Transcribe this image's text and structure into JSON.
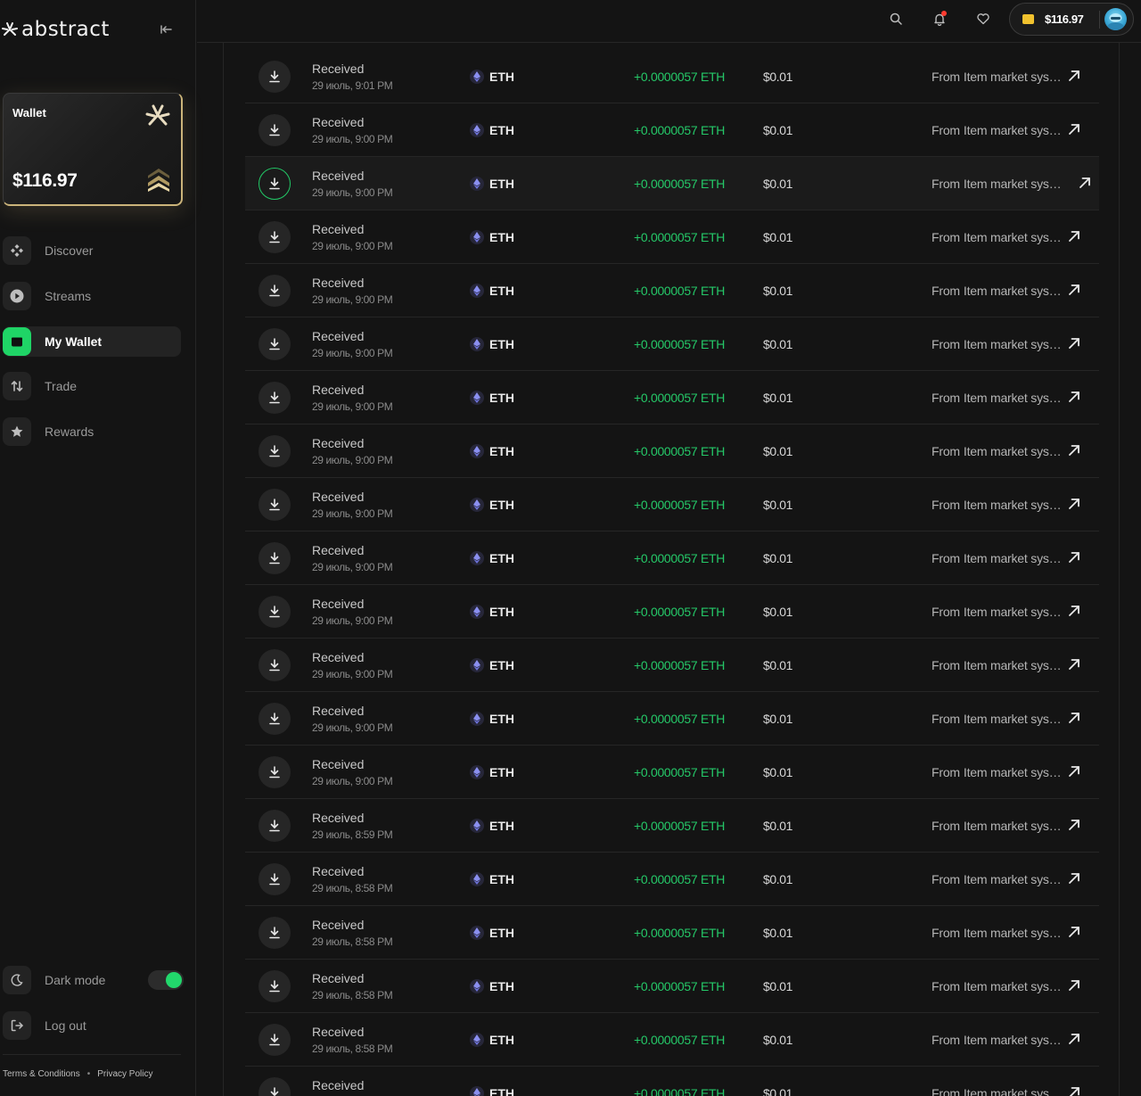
{
  "app": {
    "brand": "abstract"
  },
  "wallet_card": {
    "label": "Wallet",
    "balance": "$116.97",
    "accent_color": "#cbb47a"
  },
  "nav": {
    "items": [
      {
        "label": "Discover",
        "icon": "diamond-grid-icon",
        "active": false
      },
      {
        "label": "Streams",
        "icon": "play-icon",
        "active": false
      },
      {
        "label": "My Wallet",
        "icon": "wallet-icon",
        "active": true
      },
      {
        "label": "Trade",
        "icon": "swap-arrows-icon",
        "active": false
      },
      {
        "label": "Rewards",
        "icon": "star-icon",
        "active": false
      }
    ],
    "active_color": "#1fd466"
  },
  "bottom": {
    "dark_mode_label": "Dark mode",
    "dark_mode_on": true,
    "logout_label": "Log out"
  },
  "footer": {
    "terms": "Terms & Conditions",
    "separator": "•",
    "privacy": "Privacy Policy"
  },
  "header": {
    "balance": "$116.97",
    "has_notification": true
  },
  "transactions": [
    {
      "title": "Received",
      "date": "29 июль, 9:01 PM",
      "token": "ETH",
      "amount": "+0.0000057 ETH",
      "usd": "$0.01",
      "from_label": "From",
      "from": "Item market system"
    },
    {
      "title": "Received",
      "date": "29 июль, 9:00 PM",
      "token": "ETH",
      "amount": "+0.0000057 ETH",
      "usd": "$0.01",
      "from_label": "From",
      "from": "Item market system"
    },
    {
      "title": "Received",
      "date": "29 июль, 9:00 PM",
      "token": "ETH",
      "amount": "+0.0000057 ETH",
      "usd": "$0.01",
      "from_label": "From",
      "from": "Item market system"
    },
    {
      "title": "Received",
      "date": "29 июль, 9:00 PM",
      "token": "ETH",
      "amount": "+0.0000057 ETH",
      "usd": "$0.01",
      "from_label": "From",
      "from": "Item market system"
    },
    {
      "title": "Received",
      "date": "29 июль, 9:00 PM",
      "token": "ETH",
      "amount": "+0.0000057 ETH",
      "usd": "$0.01",
      "from_label": "From",
      "from": "Item market system"
    },
    {
      "title": "Received",
      "date": "29 июль, 9:00 PM",
      "token": "ETH",
      "amount": "+0.0000057 ETH",
      "usd": "$0.01",
      "from_label": "From",
      "from": "Item market system"
    },
    {
      "title": "Received",
      "date": "29 июль, 9:00 PM",
      "token": "ETH",
      "amount": "+0.0000057 ETH",
      "usd": "$0.01",
      "from_label": "From",
      "from": "Item market system"
    },
    {
      "title": "Received",
      "date": "29 июль, 9:00 PM",
      "token": "ETH",
      "amount": "+0.0000057 ETH",
      "usd": "$0.01",
      "from_label": "From",
      "from": "Item market system"
    },
    {
      "title": "Received",
      "date": "29 июль, 9:00 PM",
      "token": "ETH",
      "amount": "+0.0000057 ETH",
      "usd": "$0.01",
      "from_label": "From",
      "from": "Item market system"
    },
    {
      "title": "Received",
      "date": "29 июль, 9:00 PM",
      "token": "ETH",
      "amount": "+0.0000057 ETH",
      "usd": "$0.01",
      "from_label": "From",
      "from": "Item market system"
    },
    {
      "title": "Received",
      "date": "29 июль, 9:00 PM",
      "token": "ETH",
      "amount": "+0.0000057 ETH",
      "usd": "$0.01",
      "from_label": "From",
      "from": "Item market system"
    },
    {
      "title": "Received",
      "date": "29 июль, 9:00 PM",
      "token": "ETH",
      "amount": "+0.0000057 ETH",
      "usd": "$0.01",
      "from_label": "From",
      "from": "Item market system"
    },
    {
      "title": "Received",
      "date": "29 июль, 9:00 PM",
      "token": "ETH",
      "amount": "+0.0000057 ETH",
      "usd": "$0.01",
      "from_label": "From",
      "from": "Item market system"
    },
    {
      "title": "Received",
      "date": "29 июль, 9:00 PM",
      "token": "ETH",
      "amount": "+0.0000057 ETH",
      "usd": "$0.01",
      "from_label": "From",
      "from": "Item market system"
    },
    {
      "title": "Received",
      "date": "29 июль, 8:59 PM",
      "token": "ETH",
      "amount": "+0.0000057 ETH",
      "usd": "$0.01",
      "from_label": "From",
      "from": "Item market system"
    },
    {
      "title": "Received",
      "date": "29 июль, 8:58 PM",
      "token": "ETH",
      "amount": "+0.0000057 ETH",
      "usd": "$0.01",
      "from_label": "From",
      "from": "Item market system"
    },
    {
      "title": "Received",
      "date": "29 июль, 8:58 PM",
      "token": "ETH",
      "amount": "+0.0000057 ETH",
      "usd": "$0.01",
      "from_label": "From",
      "from": "Item market system"
    },
    {
      "title": "Received",
      "date": "29 июль, 8:58 PM",
      "token": "ETH",
      "amount": "+0.0000057 ETH",
      "usd": "$0.01",
      "from_label": "From",
      "from": "Item market system"
    },
    {
      "title": "Received",
      "date": "29 июль, 8:58 PM",
      "token": "ETH",
      "amount": "+0.0000057 ETH",
      "usd": "$0.01",
      "from_label": "From",
      "from": "Item market system"
    },
    {
      "title": "Received",
      "date": "",
      "token": "ETH",
      "amount": "+0.0000057 ETH",
      "usd": "$0.01",
      "from_label": "From",
      "from": "Item market system"
    }
  ],
  "hovered_row": 2,
  "colors": {
    "positive": "#25c868",
    "background": "#141414",
    "gold": "#cbb47a"
  }
}
